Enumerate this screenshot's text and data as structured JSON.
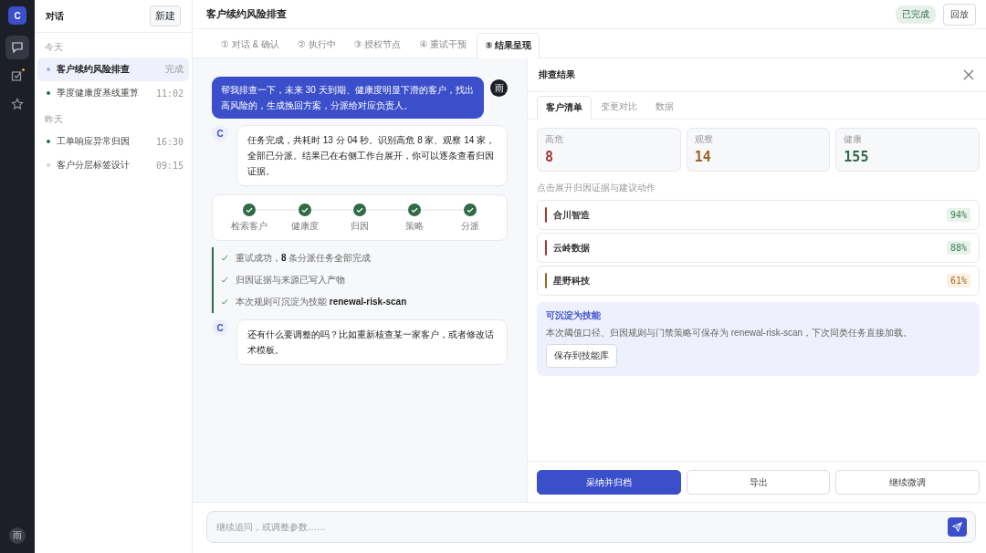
{
  "rail": {
    "logo": "C",
    "icons": [
      {
        "kind": "chat",
        "selected": true,
        "notified": false
      },
      {
        "kind": "tasks",
        "selected": false,
        "notified": true
      },
      {
        "kind": "star",
        "selected": false,
        "notified": false
      }
    ],
    "avatar": "雨"
  },
  "sidebar": {
    "title": "对话",
    "new_button": "新建",
    "groups": [
      {
        "label": "今天",
        "items": [
          {
            "title": "客户续约风险排查",
            "meta": "完成",
            "color": "#a5acec",
            "selected": true
          },
          {
            "title": "季度健康度基线重算",
            "meta": "11:02",
            "color": "#2f6b47",
            "selected": false
          }
        ]
      },
      {
        "label": "昨天",
        "items": [
          {
            "title": "工单响应异常归因",
            "meta": "16:30",
            "color": "#2f6b47",
            "selected": false
          },
          {
            "title": "客户分层标签设计",
            "meta": "09:15",
            "color": "#d4d6de",
            "selected": false
          }
        ]
      }
    ]
  },
  "header": {
    "title": "客户续约风险排查",
    "status": "已完成",
    "replay_button": "回放"
  },
  "tabs": [
    {
      "label": "① 对话 & 确认",
      "selected": false
    },
    {
      "label": "② 执行中",
      "selected": false
    },
    {
      "label": "③ 授权节点",
      "selected": false
    },
    {
      "label": "④ 重试干预",
      "selected": false
    },
    {
      "label": "⑤ 结果呈现",
      "selected": true
    }
  ],
  "messages": [
    {
      "kind": "user",
      "avatar": "雨",
      "text": "帮我排查一下，未来 30 天到期、健康度明显下滑的客户，找出高风险的，生成挽回方案，分派给对应负责人。"
    },
    {
      "kind": "assistant",
      "avatar": "C",
      "text": "任务完成，共耗时 13 分 04 秒。识别高危 8 家、观察 14 家，全部已分派。结果已在右侧工作台展开，你可以逐条查看归因证据。"
    },
    {
      "kind": "steps",
      "steps": [
        {
          "label": "检索客户",
          "done": true
        },
        {
          "label": "健康度",
          "done": true
        },
        {
          "label": "归因",
          "done": true
        },
        {
          "label": "策略",
          "done": true
        },
        {
          "label": "分派",
          "done": true
        }
      ]
    },
    {
      "kind": "log",
      "lines": [
        "重试成功，**8** 条分派任务全部完成",
        "归因证据与来源已写入产物",
        "本次规则可沉淀为技能 **renewal-risk-scan**"
      ]
    },
    {
      "kind": "assistant",
      "avatar": "C",
      "text": "还有什么要调整的吗？比如重新核查某一家客户，或者修改话术模板。"
    }
  ],
  "panel": {
    "title": "排查结果",
    "tabs": [
      {
        "label": "客户清单",
        "selected": true
      },
      {
        "label": "变更对比",
        "selected": false
      },
      {
        "label": "数据",
        "selected": false
      }
    ],
    "stats": [
      {
        "label": "高危",
        "value": "8",
        "color": "#a33a33"
      },
      {
        "label": "观察",
        "value": "14",
        "color": "#9a6422"
      },
      {
        "label": "健康",
        "value": "155",
        "color": "#2f6b47"
      }
    ],
    "hint": "点击展开归因证据与建议动作",
    "customers": [
      {
        "name": "合川智造",
        "color": "#a33a33",
        "score": "94%",
        "kind": "good"
      },
      {
        "name": "云岭数据",
        "color": "#a33a33",
        "score": "88%",
        "kind": "good"
      },
      {
        "name": "星野科技",
        "color": "#9a6422",
        "score": "61%",
        "kind": "watch"
      }
    ],
    "skill": {
      "title": "可沉淀为技能",
      "text": "本次阈值口径、归因规则与门禁策略可保存为 renewal-risk-scan，下次同类任务直接加载。",
      "button": "保存到技能库"
    },
    "actions": [
      {
        "label": "采纳并归档",
        "primary": true
      },
      {
        "label": "导出",
        "primary": false
      },
      {
        "label": "继续微调",
        "primary": false
      }
    ]
  },
  "input": {
    "placeholder": "继续追问，或调整参数……"
  }
}
